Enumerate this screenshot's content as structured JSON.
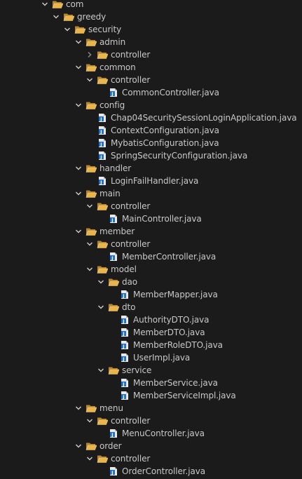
{
  "tree": [
    {
      "label": "com",
      "depth": 0,
      "type": "folder",
      "state": "expanded"
    },
    {
      "label": "greedy",
      "depth": 1,
      "type": "folder",
      "state": "expanded"
    },
    {
      "label": "security",
      "depth": 2,
      "type": "folder",
      "state": "expanded"
    },
    {
      "label": "admin",
      "depth": 3,
      "type": "folder",
      "state": "expanded"
    },
    {
      "label": "controller",
      "depth": 4,
      "type": "folder",
      "state": "collapsed"
    },
    {
      "label": "common",
      "depth": 3,
      "type": "folder",
      "state": "expanded"
    },
    {
      "label": "controller",
      "depth": 4,
      "type": "folder",
      "state": "expanded"
    },
    {
      "label": "CommonController.java",
      "depth": 5,
      "type": "file"
    },
    {
      "label": "config",
      "depth": 3,
      "type": "folder",
      "state": "expanded"
    },
    {
      "label": "Chap04SecuritySessionLoginApplication.java",
      "depth": 4,
      "type": "file"
    },
    {
      "label": "ContextConfiguration.java",
      "depth": 4,
      "type": "file"
    },
    {
      "label": "MybatisConfiguration.java",
      "depth": 4,
      "type": "file"
    },
    {
      "label": "SpringSecurityConfiguration.java",
      "depth": 4,
      "type": "file"
    },
    {
      "label": "handler",
      "depth": 3,
      "type": "folder",
      "state": "expanded"
    },
    {
      "label": "LoginFailHandler.java",
      "depth": 4,
      "type": "file"
    },
    {
      "label": "main",
      "depth": 3,
      "type": "folder",
      "state": "expanded"
    },
    {
      "label": "controller",
      "depth": 4,
      "type": "folder",
      "state": "expanded"
    },
    {
      "label": "MainController.java",
      "depth": 5,
      "type": "file"
    },
    {
      "label": "member",
      "depth": 3,
      "type": "folder",
      "state": "expanded"
    },
    {
      "label": "controller",
      "depth": 4,
      "type": "folder",
      "state": "expanded"
    },
    {
      "label": "MemberController.java",
      "depth": 5,
      "type": "file"
    },
    {
      "label": "model",
      "depth": 4,
      "type": "folder",
      "state": "expanded"
    },
    {
      "label": "dao",
      "depth": 5,
      "type": "folder",
      "state": "expanded"
    },
    {
      "label": "MemberMapper.java",
      "depth": 6,
      "type": "file"
    },
    {
      "label": "dto",
      "depth": 5,
      "type": "folder",
      "state": "expanded"
    },
    {
      "label": "AuthorityDTO.java",
      "depth": 6,
      "type": "file"
    },
    {
      "label": "MemberDTO.java",
      "depth": 6,
      "type": "file"
    },
    {
      "label": "MemberRoleDTO.java",
      "depth": 6,
      "type": "file"
    },
    {
      "label": "UserImpl.java",
      "depth": 6,
      "type": "file"
    },
    {
      "label": "service",
      "depth": 5,
      "type": "folder",
      "state": "expanded"
    },
    {
      "label": "MemberService.java",
      "depth": 6,
      "type": "file"
    },
    {
      "label": "MemberServiceImpl.java",
      "depth": 6,
      "type": "file"
    },
    {
      "label": "menu",
      "depth": 3,
      "type": "folder",
      "state": "expanded"
    },
    {
      "label": "controller",
      "depth": 4,
      "type": "folder",
      "state": "expanded"
    },
    {
      "label": "MenuController.java",
      "depth": 5,
      "type": "file"
    },
    {
      "label": "order",
      "depth": 3,
      "type": "folder",
      "state": "expanded"
    },
    {
      "label": "controller",
      "depth": 4,
      "type": "folder",
      "state": "expanded"
    },
    {
      "label": "OrderController.java",
      "depth": 5,
      "type": "file"
    }
  ],
  "icons": {
    "folder": "folder-open-icon",
    "file": "java-file-icon",
    "expanded": "chevron-down-icon",
    "collapsed": "chevron-right-icon"
  },
  "colors": {
    "background": "#1b1b1b",
    "text": "#c8c8c8",
    "folder": "#e8b54c",
    "java_badge": "#1f6fd1"
  }
}
